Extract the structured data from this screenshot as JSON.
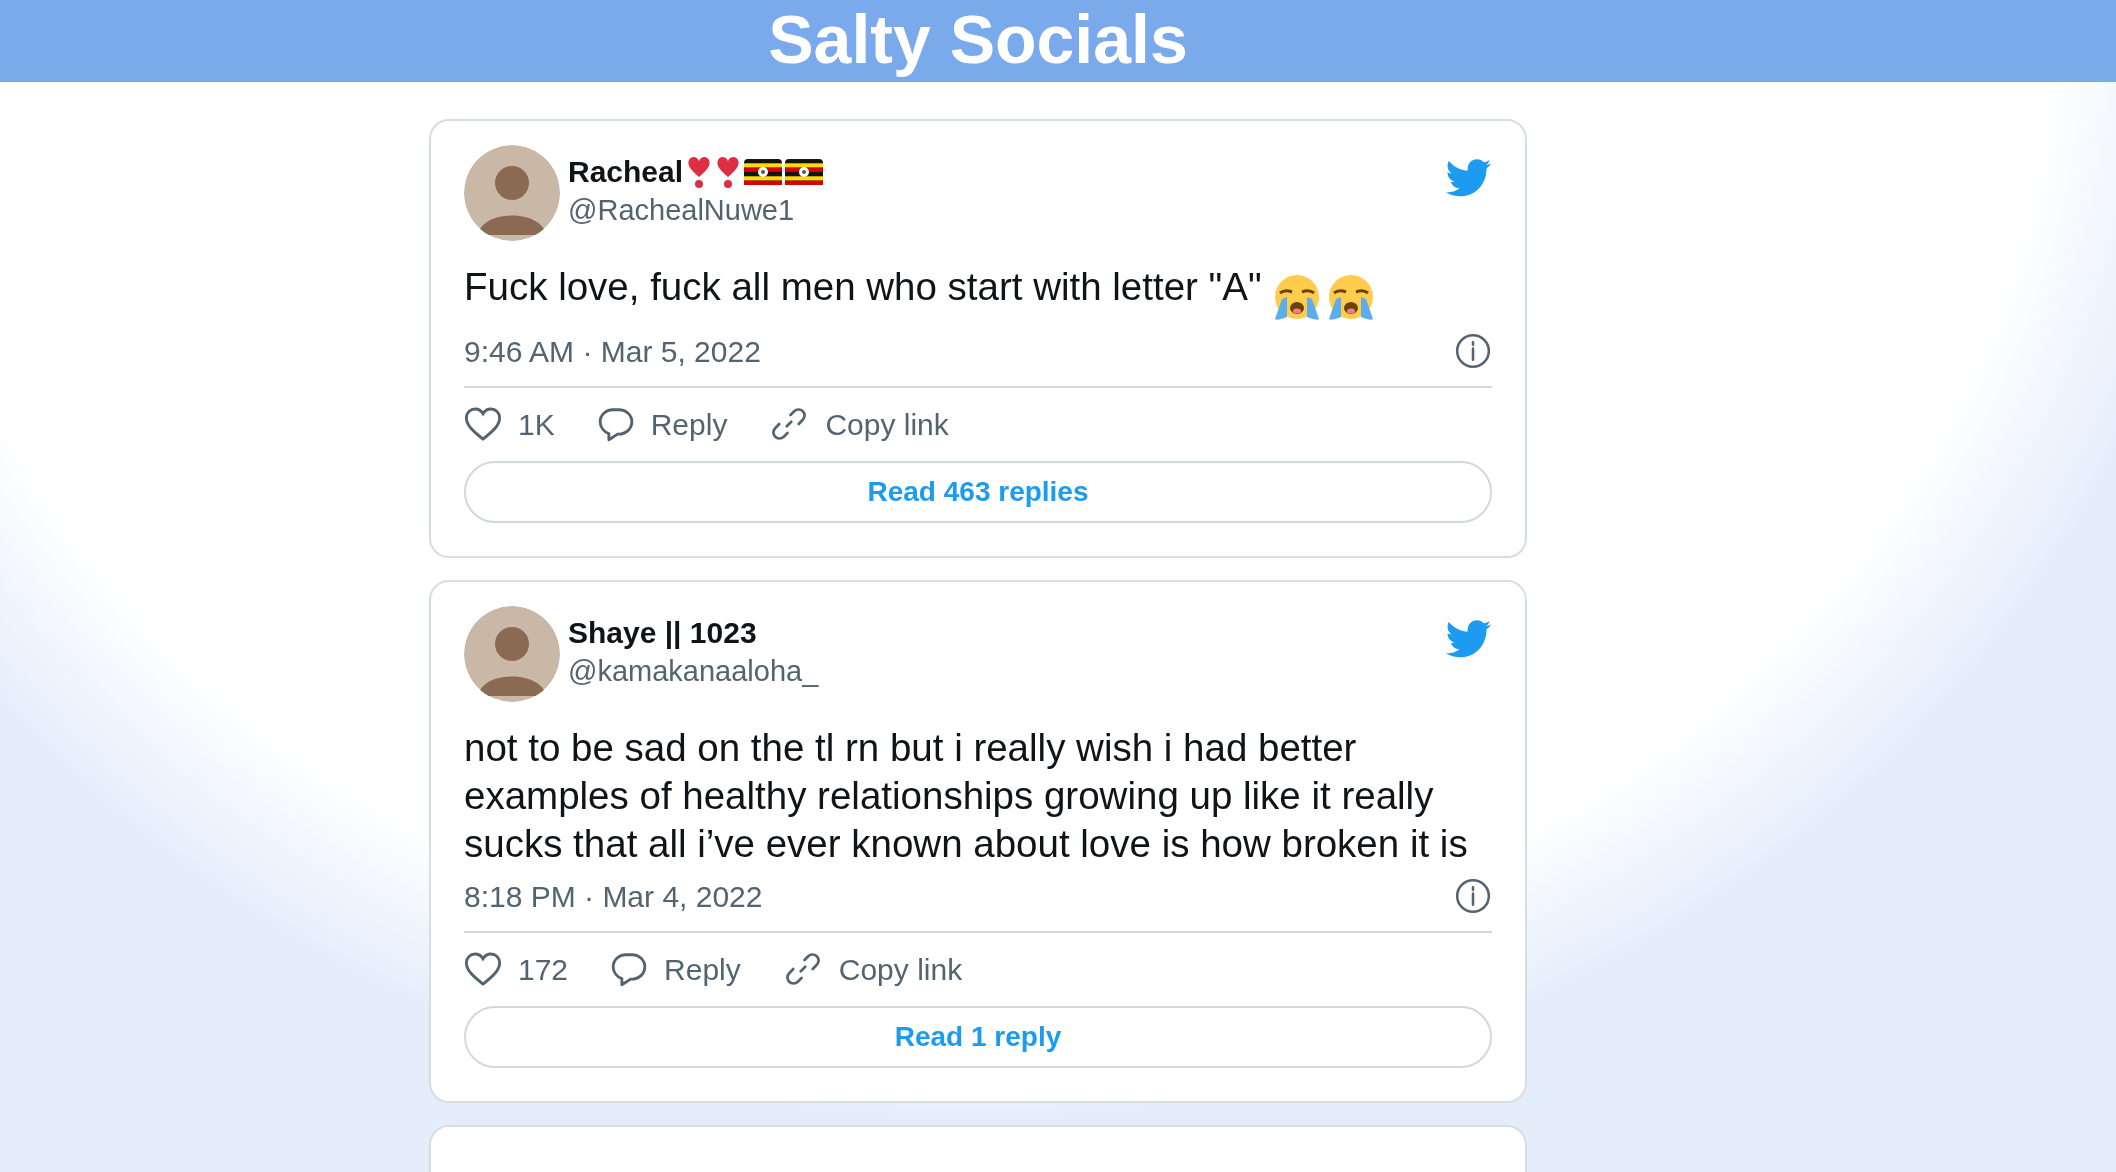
{
  "header": {
    "title": "Salty Socials"
  },
  "tweets": [
    {
      "name": "Racheal",
      "name_emojis": [
        {
          "kind": "heart_exclamation"
        },
        {
          "kind": "heart_exclamation"
        },
        {
          "kind": "uganda_flag"
        },
        {
          "kind": "uganda_flag"
        }
      ],
      "handle": "@RachealNuwe1",
      "text": "Fuck love, fuck all men who start with letter \"A\"",
      "text_emojis": [
        {
          "kind": "loudly_crying"
        },
        {
          "kind": "loudly_crying"
        }
      ],
      "time": "9:46 AM · Mar 5, 2022",
      "likes": "1K",
      "reply": "Reply",
      "copy": "Copy link",
      "read": "Read 463 replies"
    },
    {
      "name": "Shaye || 1023",
      "handle": "@kamakanaaloha_",
      "text": "not to be sad on the tl rn but i really wish i had better examples of healthy relationships growing up like it really sucks that all i’ve ever known about love is how broken it is",
      "time": "8:18 PM · Mar 4, 2022",
      "likes": "172",
      "reply": "Reply",
      "copy": "Copy link",
      "read": "Read 1 reply"
    }
  ]
}
